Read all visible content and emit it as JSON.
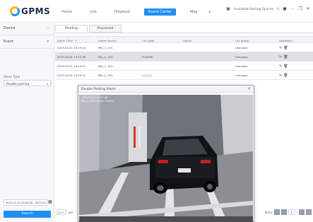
{
  "app": {
    "logo_text": "GPMS"
  },
  "nav": {
    "items": [
      {
        "label": "Home"
      },
      {
        "label": "Live"
      },
      {
        "label": "Playback"
      },
      {
        "label": "Event Center",
        "active": true
      },
      {
        "label": "Map"
      }
    ],
    "plus": "+"
  },
  "topbar_right": {
    "parking_label": "Available Parking Spaces",
    "count": "0"
  },
  "sidebar": {
    "sections": [
      {
        "label": "Device"
      },
      {
        "label": "Event"
      }
    ],
    "alarm_type_label": "Alarm Type",
    "alarm_type_value": "Double parking",
    "date_range": "2023-01-05 00:00:00 - 2023-01-06",
    "search_label": "Search"
  },
  "tabs": [
    {
      "label": "Pending",
      "active": true
    },
    {
      "label": "Processed",
      "active": false
    }
  ],
  "table": {
    "columns": [
      "Alarm Time",
      "Alarm Source",
      "Car plate",
      "Owner",
      "Car group",
      "Operation"
    ],
    "rows": [
      {
        "time": "2023-03-01 15:13:10",
        "source": "Mfy_C_315",
        "plate": "",
        "owner": "",
        "group": "Unknown"
      },
      {
        "time": "2023-03-01 15:12:48",
        "source": "Mfy_C_315",
        "plate": "FGA036",
        "owner": "",
        "group": "Unknown",
        "selected": true
      },
      {
        "time": "2023-03-01 15:10:47",
        "source": "Mfy_C_315",
        "plate": "",
        "owner": "",
        "group": "Unknown"
      },
      {
        "time": "2023-03-01 15:10:41",
        "source": "Mfy_C_315",
        "plate": "",
        "owner": "",
        "group": "Unknown"
      }
    ]
  },
  "pager": {
    "page_size": "20",
    "per_label": "per",
    "total_label": "Items",
    "current_page": "1"
  },
  "popup": {
    "title": "Double Parking Alarm",
    "osd_line1": "2023-03-01 15:12:48",
    "osd_line2": "Mfy_C_315  Double Parking"
  },
  "colors": {
    "accent": "#1f8ef1",
    "logo_orange": "#ffb400"
  }
}
